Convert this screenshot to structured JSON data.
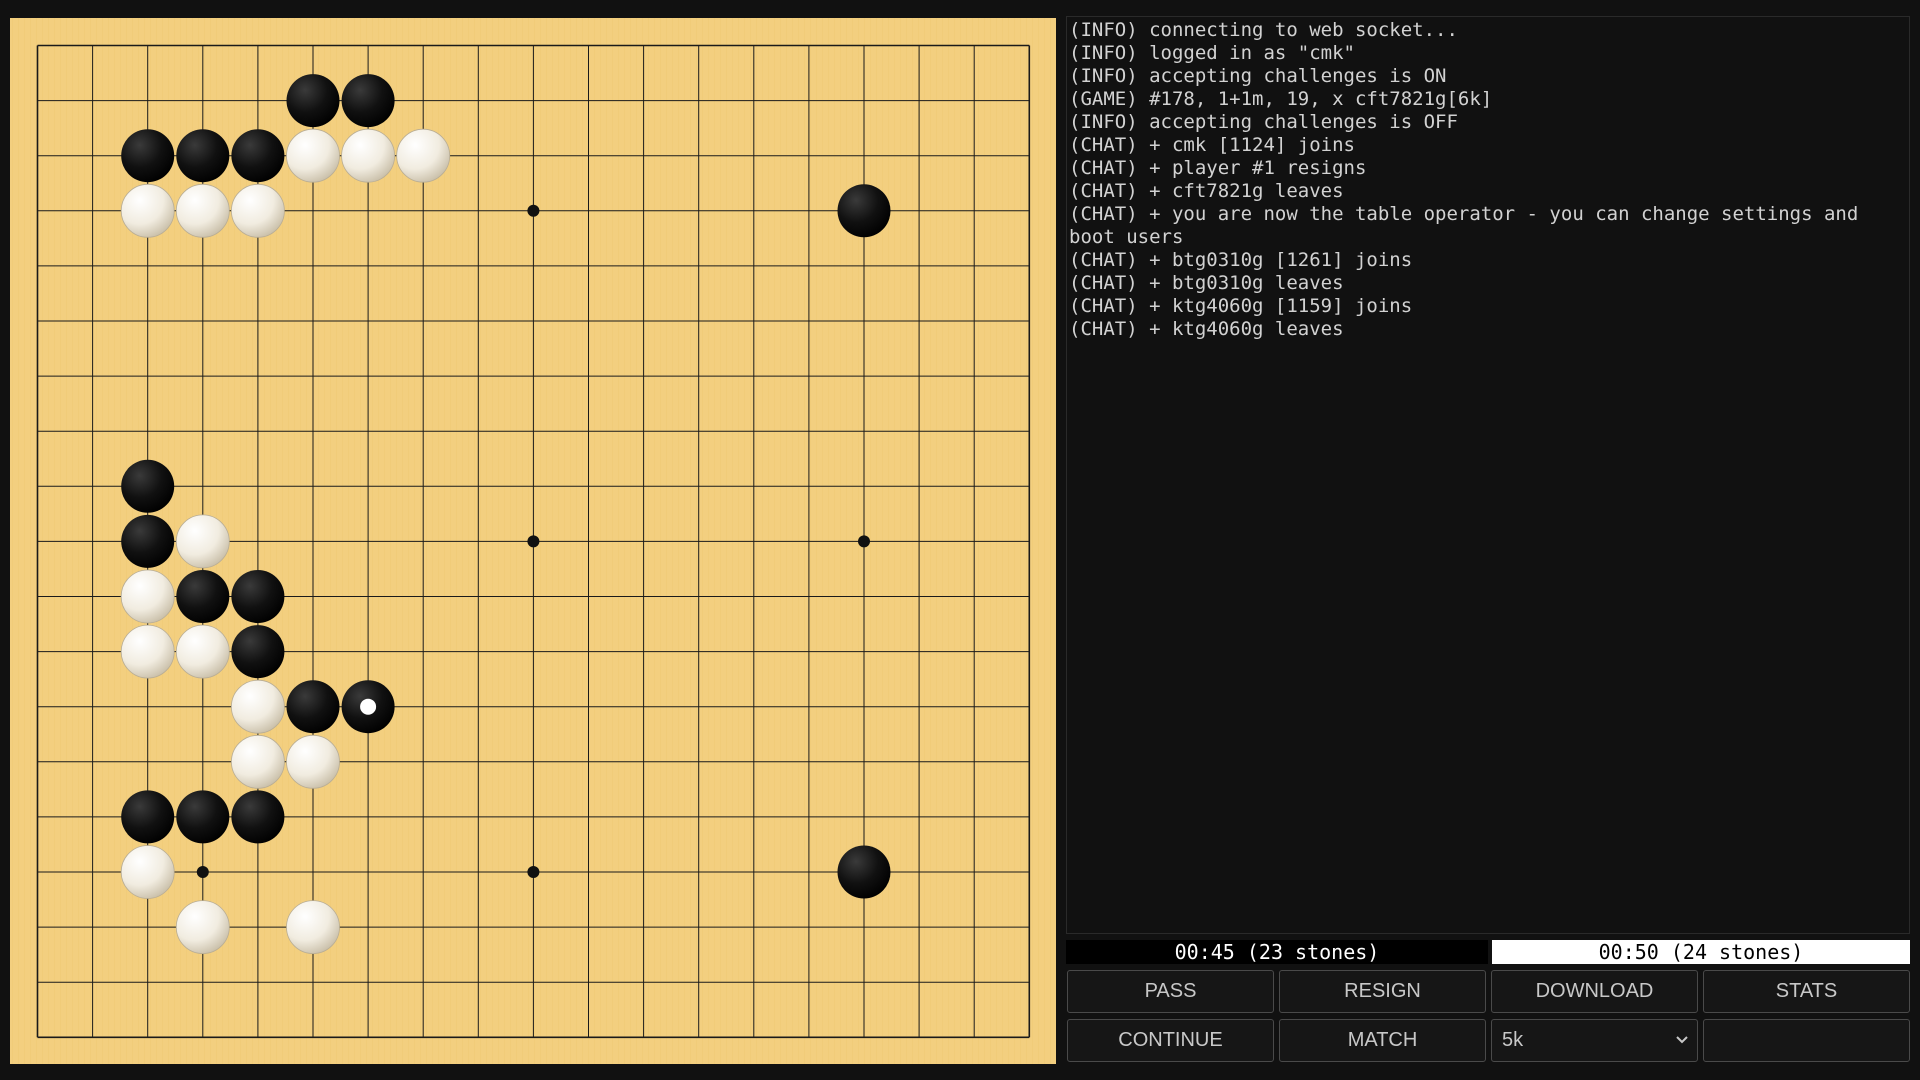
{
  "board": {
    "size": 19,
    "colors": {
      "wood": "#f3cf7f",
      "line": "#1a1a1a",
      "black_stone": "#111111",
      "white_stone": "#f4f0e6"
    },
    "hoshi": [
      [
        3,
        9
      ],
      [
        3,
        15
      ],
      [
        9,
        9
      ],
      [
        9,
        15
      ],
      [
        15,
        3
      ],
      [
        15,
        9
      ],
      [
        15,
        15
      ]
    ],
    "stones": [
      {
        "color": "black",
        "row": 1,
        "col": 5
      },
      {
        "color": "black",
        "row": 1,
        "col": 6
      },
      {
        "color": "black",
        "row": 2,
        "col": 2
      },
      {
        "color": "black",
        "row": 2,
        "col": 3
      },
      {
        "color": "black",
        "row": 2,
        "col": 4
      },
      {
        "color": "white",
        "row": 2,
        "col": 5
      },
      {
        "color": "white",
        "row": 2,
        "col": 6
      },
      {
        "color": "white",
        "row": 2,
        "col": 7
      },
      {
        "color": "white",
        "row": 3,
        "col": 2
      },
      {
        "color": "white",
        "row": 3,
        "col": 3
      },
      {
        "color": "white",
        "row": 3,
        "col": 4
      },
      {
        "color": "black",
        "row": 3,
        "col": 15
      },
      {
        "color": "black",
        "row": 8,
        "col": 2
      },
      {
        "color": "black",
        "row": 9,
        "col": 2
      },
      {
        "color": "white",
        "row": 9,
        "col": 3
      },
      {
        "color": "white",
        "row": 10,
        "col": 2
      },
      {
        "color": "black",
        "row": 10,
        "col": 3
      },
      {
        "color": "black",
        "row": 10,
        "col": 4
      },
      {
        "color": "white",
        "row": 11,
        "col": 2
      },
      {
        "color": "white",
        "row": 11,
        "col": 3
      },
      {
        "color": "black",
        "row": 11,
        "col": 4
      },
      {
        "color": "white",
        "row": 12,
        "col": 4
      },
      {
        "color": "black",
        "row": 12,
        "col": 5
      },
      {
        "color": "black",
        "row": 12,
        "col": 6,
        "last_move": true
      },
      {
        "color": "white",
        "row": 13,
        "col": 4
      },
      {
        "color": "white",
        "row": 13,
        "col": 5
      },
      {
        "color": "black",
        "row": 14,
        "col": 2
      },
      {
        "color": "black",
        "row": 14,
        "col": 3
      },
      {
        "color": "black",
        "row": 14,
        "col": 4
      },
      {
        "color": "white",
        "row": 15,
        "col": 2
      },
      {
        "color": "black",
        "row": 15,
        "col": 15
      },
      {
        "color": "white",
        "row": 16,
        "col": 3
      },
      {
        "color": "white",
        "row": 16,
        "col": 5
      }
    ]
  },
  "log": [
    "(INFO) connecting to web socket...",
    "(INFO) logged in as \"cmk\"",
    "(INFO) accepting challenges is ON",
    "(GAME) #178, 1+1m, 19, x cft7821g[6k]",
    "(INFO) accepting challenges is OFF",
    "(CHAT) + cmk [1124] joins",
    "(CHAT) + player #1 resigns",
    "(CHAT) + cft7821g leaves",
    "(CHAT) + you are now the table operator - you can change settings and boot users",
    "(CHAT) + btg0310g [1261] joins",
    "(CHAT) + btg0310g leaves",
    "(CHAT) + ktg4060g [1159] joins",
    "(CHAT) + ktg4060g leaves"
  ],
  "clocks": {
    "black": "00:45 (23 stones)",
    "white": "00:50 (24 stones)"
  },
  "buttons": {
    "pass": "PASS",
    "resign": "RESIGN",
    "download": "DOWNLOAD",
    "stats": "STATS",
    "continue": "CONTINUE",
    "match": "MATCH"
  },
  "rank_select": {
    "value": "5k",
    "icon": "chevron-down-icon"
  }
}
